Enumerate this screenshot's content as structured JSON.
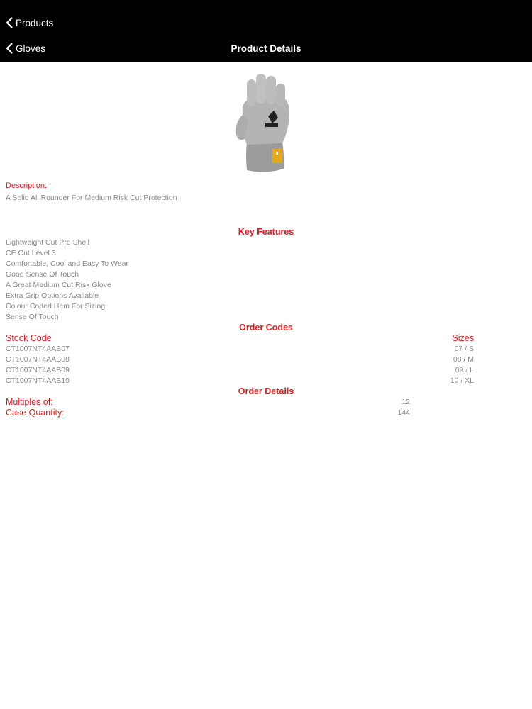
{
  "navbar": {
    "back_top_label": "Products",
    "back_bottom_label": "Gloves",
    "title": "Product Details"
  },
  "product": {
    "image_icon": "grey-cut-resistant-glove-image",
    "description_label": "Description:",
    "description": "A Solid All Rounder For Medium Risk Cut Protection"
  },
  "key_features": {
    "heading": "Key Features",
    "items": [
      "Lightweight Cut Pro Shell",
      "CE Cut Level 3",
      "Comfortable, Cool and Easy To Wear",
      "Good Sense Of Touch",
      "A Great Medium Cut Risk Glove",
      "Extra Grip Options Available",
      "Colour Coded Hem For Sizing",
      "Sense Of Touch"
    ]
  },
  "order_codes": {
    "heading": "Order Codes",
    "col_stock_code": "Stock Code",
    "col_sizes": "Sizes",
    "rows": [
      {
        "code": "CT1007NT4AAB07",
        "size": "07 / S"
      },
      {
        "code": "CT1007NT4AAB08",
        "size": "08 / M"
      },
      {
        "code": "CT1007NT4AAB09",
        "size": "09 / L"
      },
      {
        "code": "CT1007NT4AAB10",
        "size": "10 / XL"
      }
    ]
  },
  "order_details": {
    "heading": "Order Details",
    "multiples_label": "Multiples of:",
    "multiples_value": "12",
    "case_quantity_label": "Case Quantity:",
    "case_quantity_value": "144"
  },
  "colors": {
    "accent_red": "#e0191e",
    "navbar_bg": "#000000",
    "body_text_grey": "#8a8a8a"
  }
}
